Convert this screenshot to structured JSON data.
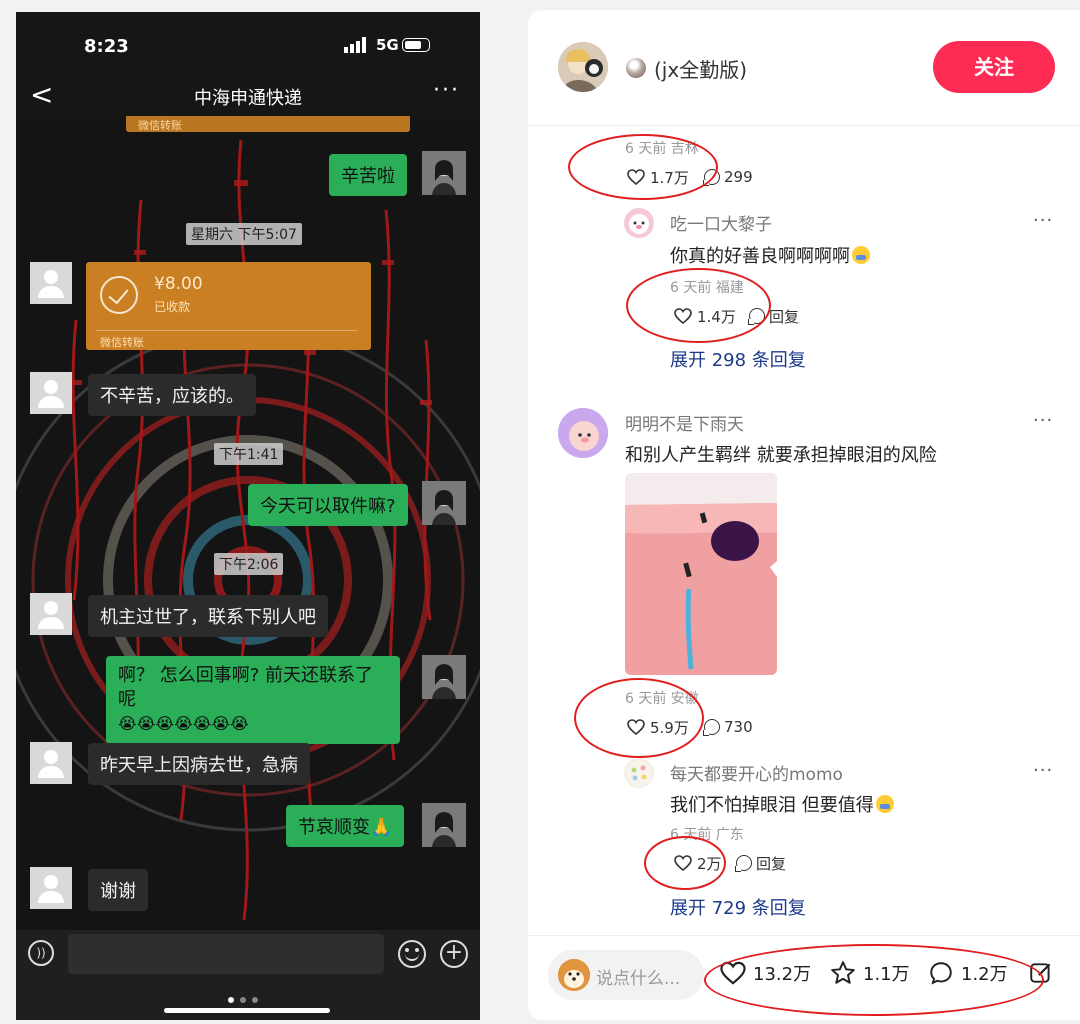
{
  "chat": {
    "status_time": "8:23",
    "network": "5G",
    "back_glyph": "<",
    "title": "中海申通快递",
    "more_glyph": "···",
    "transfer_top_label": "微信转账",
    "msg_thanks": "辛苦啦",
    "ts1": "星期六 下午5:07",
    "transfer": {
      "amount": "¥8.00",
      "status": "已收款",
      "label": "微信转账"
    },
    "msg_reply1": "不辛苦，应该的。",
    "ts2": "下午1:41",
    "msg_pickup": "今天可以取件嘛?",
    "ts3": "下午2:06",
    "msg_died": "机主过世了，联系下别人吧",
    "msg_what": "啊？ 怎么回事啊? 前天还联系了呢",
    "msg_what_emoji": "😭😭😭😭😭😭😭",
    "msg_cause": "昨天早上因病去世，急病",
    "msg_condolence": "节哀顺变🙏",
    "msg_thank_you": "谢谢",
    "icons": [
      "signal-icon",
      "battery-icon",
      "voice-icon",
      "emoji-icon",
      "plus-icon"
    ]
  },
  "panel": {
    "author_name": "(jx全勤版)",
    "follow_label": "关注",
    "c0": {
      "meta": "6 天前 吉林",
      "likes": "1.7万",
      "replies": "299"
    },
    "r1": {
      "name": "吃一口大黎子",
      "text": "你真的好善良啊啊啊啊",
      "meta": "6 天前 福建",
      "likes": "1.4万",
      "reply_label": "回复",
      "more": "···"
    },
    "expand1": "展开 298 条回复",
    "c2": {
      "name": "明明不是下雨天",
      "text": "和别人产生羁绊 就要承担掉眼泪的风险",
      "meta": "6 天前 安徽",
      "likes": "5.9万",
      "replies": "730",
      "more": "···"
    },
    "r2": {
      "name": "每天都要开心的momo",
      "text": "我们不怕掉眼泪 但要值得",
      "meta": "6 天前 广东",
      "likes": "2万",
      "reply_label": "回复",
      "more": "···"
    },
    "expand2": "展开 729 条回复",
    "bottom": {
      "placeholder": "说点什么...",
      "likes": "13.2万",
      "stars": "1.1万",
      "comments": "1.2万"
    },
    "colors": {
      "accent": "#fe2c55",
      "link": "#1b3a8c",
      "annotation": "#e01e1e",
      "wechat_green": "#2bae58",
      "transfer_orange": "#c97f22"
    }
  }
}
